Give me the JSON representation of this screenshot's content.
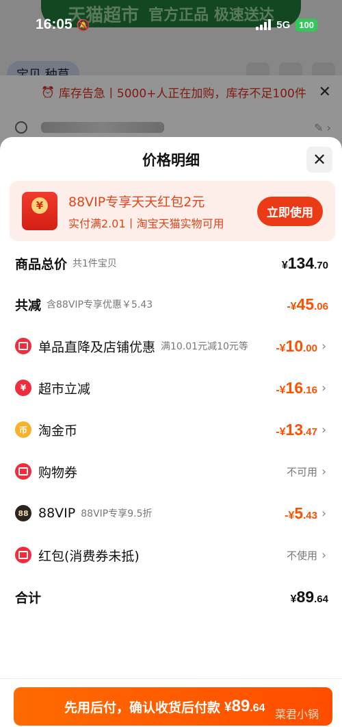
{
  "status_bar": {
    "time": "16:05",
    "network": "5G",
    "battery": "100"
  },
  "background": {
    "banner_title": "天猫超市",
    "banner_sub": "官方正品 极速送达",
    "tab": "宝贝 种草",
    "alert_text": "库存告急丨5000+人正在加购，库存不足100件"
  },
  "sheet": {
    "title": "价格明细",
    "promo": {
      "title": "88VIP专享天天红包2元",
      "subtitle": "实付满2.01丨淘宝天猫实物可用",
      "button": "立即使用",
      "coin": "¥"
    },
    "rows": {
      "total": {
        "label": "商品总价",
        "note": "共1件宝贝",
        "sym": "¥",
        "int": "134",
        "dec": ".70"
      },
      "reduce": {
        "label": "共减",
        "note": "含88VIP专享优惠￥5.43",
        "sym": "-¥",
        "int": "45",
        "dec": ".06"
      },
      "shop": {
        "label": "单品直降及店铺优惠",
        "note": "满10.01元减10元等",
        "sym": "-¥",
        "int": "10",
        "dec": ".00"
      },
      "market": {
        "label": "超市立减",
        "sym": "-¥",
        "int": "16",
        "dec": ".16"
      },
      "coins": {
        "label": "淘金币",
        "sym": "-¥",
        "int": "13",
        "dec": ".47"
      },
      "voucher": {
        "label": "购物券",
        "status": "不可用"
      },
      "vip": {
        "label": "88VIP",
        "note": "88VIP专享9.5折",
        "sym": "-¥",
        "int": "5",
        "dec": ".43",
        "icon_text": "88"
      },
      "redpacket": {
        "label": "红包(消费券未抵)",
        "status": "不使用"
      },
      "sum": {
        "label": "合计",
        "sym": "¥",
        "int": "89",
        "dec": ".64"
      }
    },
    "bottom": {
      "button_text": "先用后付，确认收货后付款",
      "amount_sym": "¥",
      "amount_int": "89",
      "amount_dec": ".64",
      "watermark": "菜君小锅"
    },
    "colors": {
      "accent": "#ff5000",
      "promo_bg": "#fdeee9",
      "button": "#ff5a00"
    }
  }
}
